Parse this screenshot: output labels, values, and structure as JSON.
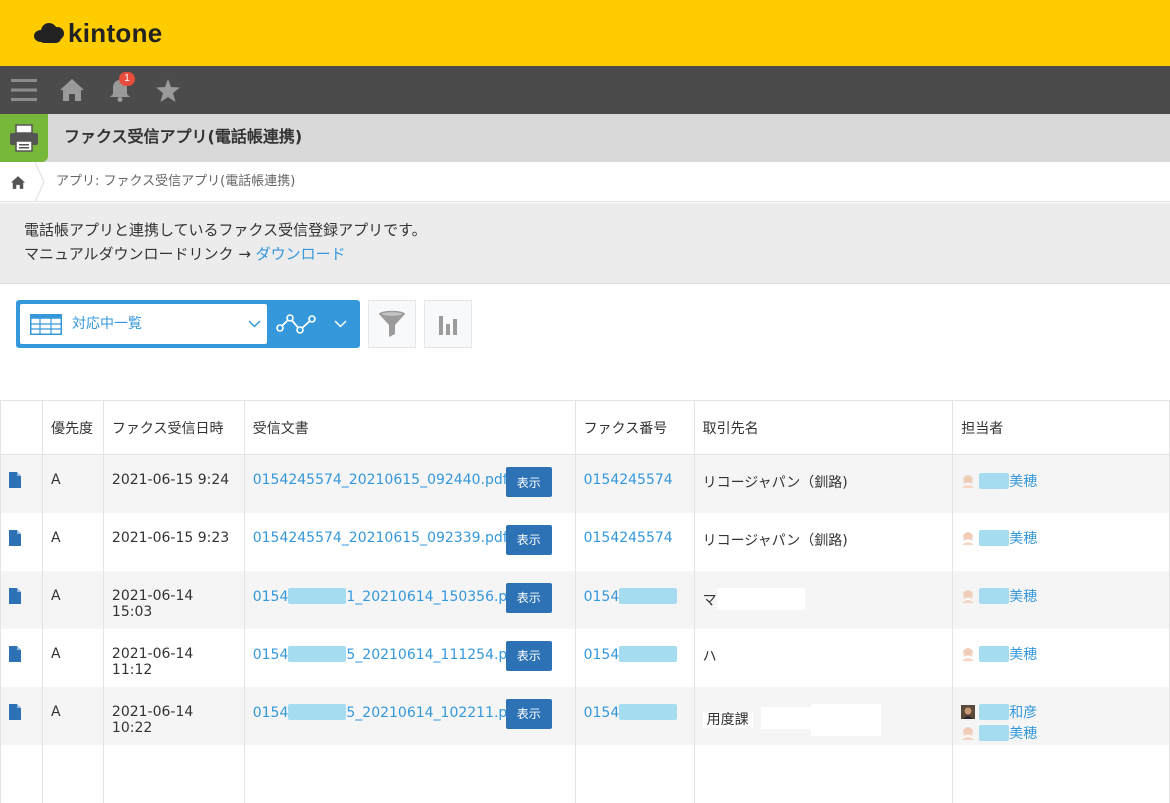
{
  "brand": {
    "logo_text": "kintone",
    "colors": {
      "topbar": "#ffcc00",
      "navbar": "#4b4b4b",
      "accent": "#3498db"
    }
  },
  "nav": {
    "notification_count": "1",
    "icons": [
      "menu-icon",
      "home-icon",
      "bell-icon",
      "star-icon"
    ]
  },
  "app": {
    "title": "ファクス受信アプリ(電話帳連携)",
    "icon": "printer-icon"
  },
  "breadcrumb": {
    "text": "アプリ: ファクス受信アプリ(電話帳連携)"
  },
  "description": {
    "line1": "電話帳アプリと連携しているファクス受信登録アプリです。",
    "line2_prefix": "マニュアルダウンロードリンク → ",
    "link_label": "ダウンロード"
  },
  "view": {
    "selected": "対応中一覧"
  },
  "table": {
    "headers": [
      "優先度",
      "ファクス受信日時",
      "受信文書",
      "ファクス番号",
      "取引先名",
      "担当者"
    ],
    "show_label": "表示",
    "rows": [
      {
        "priority": "A",
        "datetime": "2021-06-15 9:24",
        "doc": "0154245574_20210615_092440.pdf",
        "fax": "0154245574",
        "client": "リコージャパン（釧路)",
        "staff": [
          {
            "name": "美穂"
          }
        ]
      },
      {
        "priority": "A",
        "datetime": "2021-06-15 9:23",
        "doc": "0154245574_20210615_092339.pdf",
        "fax": "0154245574",
        "client": "リコージャパン（釧路)",
        "staff": [
          {
            "name": "美穂"
          }
        ]
      },
      {
        "priority": "A",
        "datetime": "2021-06-14 15:03",
        "doc_prefix": "0154",
        "doc_suffix": "1_20210614_150356.pdf",
        "fax_prefix": "0154",
        "client": "マ",
        "staff": [
          {
            "name": "美穂"
          }
        ]
      },
      {
        "priority": "A",
        "datetime": "2021-06-14 11:12",
        "doc_prefix": "0154",
        "doc_suffix": "5_20210614_111254.pdf",
        "fax_prefix": "0154",
        "client": "ハ",
        "staff": [
          {
            "name": "美穂"
          }
        ]
      },
      {
        "priority": "A",
        "datetime": "2021-06-14 10:22",
        "doc_prefix": "0154",
        "doc_suffix": "5_20210614_102211.pdf",
        "fax_prefix": "0154",
        "client": "用度課",
        "staff": [
          {
            "name": "和彦"
          },
          {
            "name": "美穂"
          }
        ]
      }
    ]
  }
}
